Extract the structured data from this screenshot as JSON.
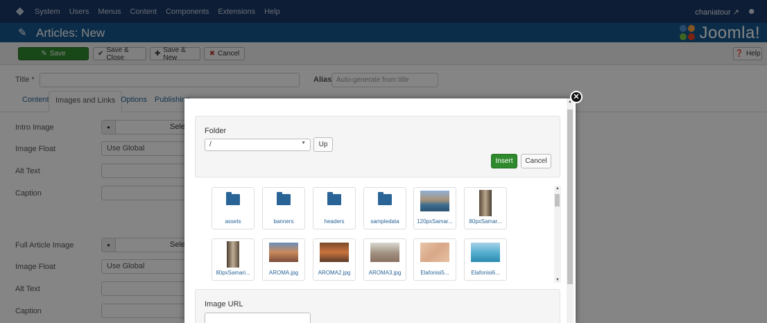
{
  "topnav": {
    "menu": [
      "System",
      "Users",
      "Menus",
      "Content",
      "Components",
      "Extensions",
      "Help"
    ],
    "user": "chaniatour ↗"
  },
  "titlebar": {
    "title": "Articles: New",
    "brand": "Joomla!"
  },
  "toolbar": {
    "save": "Save",
    "save_close": "Save & Close",
    "save_new": "Save & New",
    "cancel": "Cancel",
    "help": "Help"
  },
  "form": {
    "title_label": "Title *",
    "alias_label": "Alias",
    "alias_placeholder": "Auto-generate from title"
  },
  "tabs": [
    "Content",
    "Images and Links",
    "Options",
    "Publishing"
  ],
  "images_tab": {
    "intro_image": "Intro Image",
    "image_float": "Image Float",
    "alt_text": "Alt Text",
    "caption": "Caption",
    "full_article_image": "Full Article Image",
    "select": "Sele",
    "use_global": "Use Global"
  },
  "modal": {
    "folder_label": "Folder",
    "folder_value": "/",
    "up": "Up",
    "insert": "Insert",
    "cancel": "Cancel",
    "image_url_label": "Image URL",
    "items": [
      {
        "name": "assets",
        "kind": "folder"
      },
      {
        "name": "banners",
        "kind": "folder"
      },
      {
        "name": "headers",
        "kind": "folder"
      },
      {
        "name": "sampledata",
        "kind": "folder"
      },
      {
        "name": "120pxSamar...",
        "kind": "image"
      },
      {
        "name": "80pxSamar...",
        "kind": "image"
      },
      {
        "name": "80pxSamari...",
        "kind": "image"
      },
      {
        "name": "AROMA.jpg",
        "kind": "image"
      },
      {
        "name": "AROMA2.jpg",
        "kind": "image"
      },
      {
        "name": "AROMA3.jpg",
        "kind": "image"
      },
      {
        "name": "Elafonisi5...",
        "kind": "image"
      },
      {
        "name": "Elafonisi6...",
        "kind": "image"
      }
    ]
  },
  "colors": {
    "topnav": "#1a3867",
    "titlebar": "#17568c",
    "success": "#2f8a2d",
    "link": "#2a6496"
  }
}
